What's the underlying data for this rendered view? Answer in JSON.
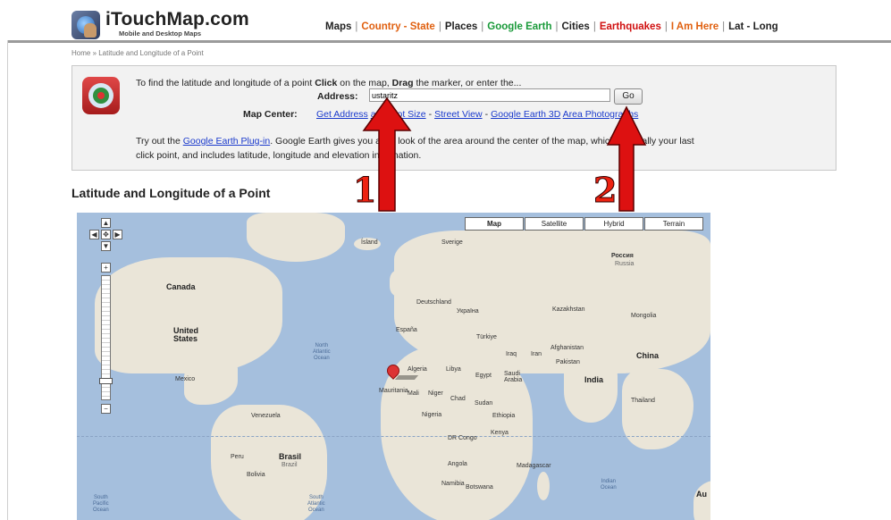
{
  "header": {
    "site_name": "iTouchMap.com",
    "tagline": "Mobile and Desktop Maps",
    "nav": [
      {
        "label": "Maps",
        "color": "#222222"
      },
      {
        "label": "Country - State",
        "color": "#e06010"
      },
      {
        "label": "Places",
        "color": "#222222"
      },
      {
        "label": "Google Earth",
        "color": "#1a9a3a"
      },
      {
        "label": "Cities",
        "color": "#222222"
      },
      {
        "label": "Earthquakes",
        "color": "#d01010"
      },
      {
        "label": "I Am Here",
        "color": "#e06010"
      },
      {
        "label": "Lat - Long",
        "color": "#222222"
      }
    ],
    "separator": "|"
  },
  "breadcrumb": "Home » Latitude and Longitude of a Point",
  "info": {
    "instr_pre": "To find the latitude and longitude of a point ",
    "instr_click": "Click",
    "instr_mid": " on the map, ",
    "instr_drag": "Drag",
    "instr_post": " the marker, or enter the...",
    "address_label": "Address:",
    "address_value": "ustaritz",
    "go_label": "Go",
    "map_center_label": "Map Center:",
    "map_center_links": [
      "Get Address",
      "and Plot Size",
      "Street View",
      "Google Earth 3D",
      "Area Photographs"
    ],
    "plugin_pre": "Try out the ",
    "plugin_link": "Google Earth Plug-in",
    "plugin_post": ". Google Earth gives you a 3D look of the area around the center of the map, which is usually your last",
    "plugin_line2": "click point, and includes latitude, longitude and elevation information."
  },
  "map_heading": "Latitude and Longitude of a Point",
  "map": {
    "types": [
      "Map",
      "Satellite",
      "Hybrid",
      "Terrain"
    ],
    "active_type": "Map",
    "labels": {
      "canada": "Canada",
      "united_states": "United\nStates",
      "mexico": "Mexico",
      "venezuela": "Venezuela",
      "brasil": "Brasil",
      "brazil": "Brazil",
      "bolivia": "Bolivia",
      "peru": "Peru",
      "russia": "Россия",
      "russia_en": "Russia",
      "china": "China",
      "india": "India",
      "kazakhstan": "Kazakhstan",
      "mongolia": "Mongolia",
      "iran": "Iran",
      "iraq": "Iraq",
      "afghanistan": "Afghanistan",
      "pakistan": "Pakistan",
      "turkiye": "Türkiye",
      "algeria": "Algeria",
      "libya": "Libya",
      "egypt": "Egypt",
      "mali": "Mali",
      "niger": "Niger",
      "chad": "Chad",
      "sudan": "Sudan",
      "nigeria": "Nigeria",
      "ethiopia": "Ethiopia",
      "kenya": "Kenya",
      "dr_congo": "DR Congo",
      "angola": "Angola",
      "namibia": "Namibia",
      "botswana": "Botswana",
      "madagascar": "Madagascar",
      "mauritania": "Mauritania",
      "saudi_arabia": "Saudi\nArabia",
      "deutschland": "Deutschland",
      "espana": "España",
      "ukraine": "Україна",
      "sverige": "Sverige",
      "iceland": "Ísland",
      "thailand": "Thailand",
      "north_atlantic": "North\nAtlantic\nOcean",
      "south_atlantic": "South\nAtlantic\nOcean",
      "south_pacific": "South\nPacific\nOcean",
      "indian_ocean": "Indian\nOcean",
      "au": "Au"
    }
  },
  "annotations": {
    "arrow1_label": "1",
    "arrow2_label": "2",
    "arrow_color": "#dd1111"
  }
}
